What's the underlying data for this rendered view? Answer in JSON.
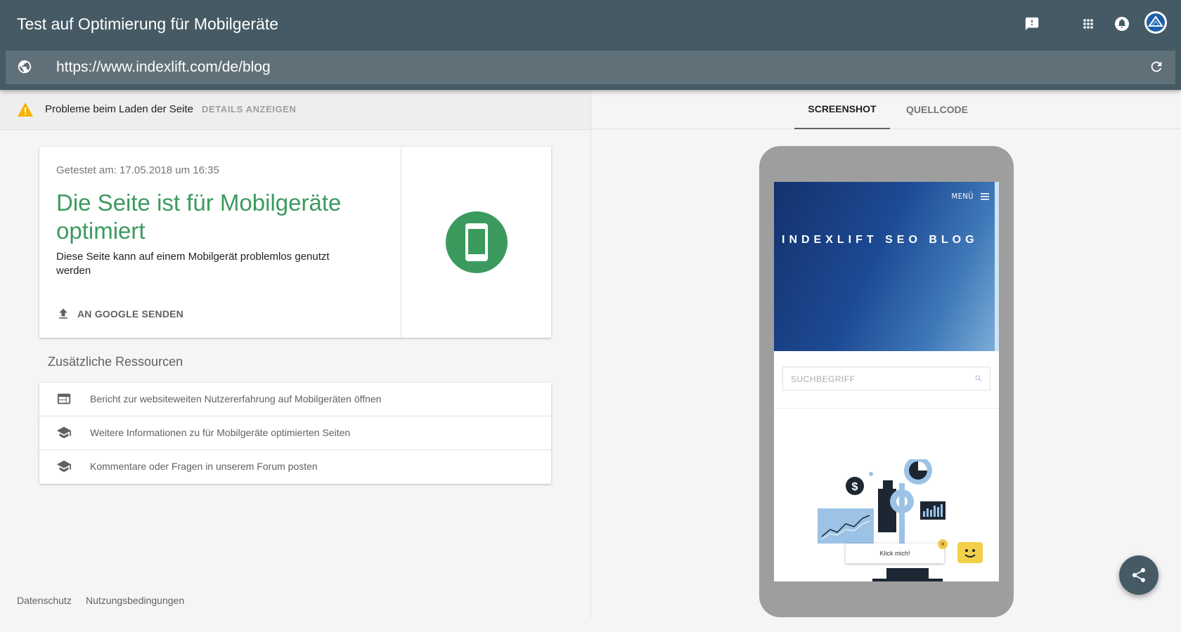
{
  "header": {
    "title": "Test auf Optimierung für Mobilgeräte",
    "icons": [
      "feedback-icon",
      "apps-grid-icon",
      "notifications-icon",
      "account-avatar"
    ]
  },
  "url_bar": {
    "url": "https://www.indexlift.com/de/blog",
    "icons": [
      "globe-icon",
      "reload-icon"
    ]
  },
  "warning": {
    "text": "Probleme beim Laden der Seite",
    "link": "DETAILS ANZEIGEN",
    "icon": "warning-icon"
  },
  "result": {
    "tested_at": "Getestet am: 17.05.2018 um 16:35",
    "headline": "Die Seite ist für Mobilgeräte optimiert",
    "description": "Diese Seite kann auf einem Mobilgerät problemlos genutzt werden",
    "send_button": "AN GOOGLE SENDEN",
    "status_color": "#3c9a5f"
  },
  "resources": {
    "title": "Zusätzliche Ressourcen",
    "items": [
      {
        "label": "Bericht zur websiteweiten Nutzererfahrung auf Mobilgeräten öffnen",
        "icon": "web-report-icon"
      },
      {
        "label": "Weitere Informationen zu für Mobilgeräte optimierten Seiten",
        "icon": "school-icon"
      },
      {
        "label": "Kommentare oder Fragen in unserem Forum posten",
        "icon": "school-icon"
      }
    ]
  },
  "footer": {
    "privacy": "Datenschutz",
    "terms": "Nutzungsbedingungen"
  },
  "tabs": [
    {
      "label": "SCREENSHOT",
      "active": true
    },
    {
      "label": "QUELLCODE",
      "active": false
    }
  ],
  "preview": {
    "menu_label": "MENÜ",
    "blog_title": "INDEXLIFT SEO BLOG",
    "search_placeholder": "SUCHBEGRIFF",
    "popup_text": "Klick mich!",
    "popup_close": "×"
  },
  "colors": {
    "header_bg": "#455a64",
    "url_bar_bg": "#607078",
    "success_green": "#3c9a5f",
    "warning_yellow": "#f4b400"
  }
}
